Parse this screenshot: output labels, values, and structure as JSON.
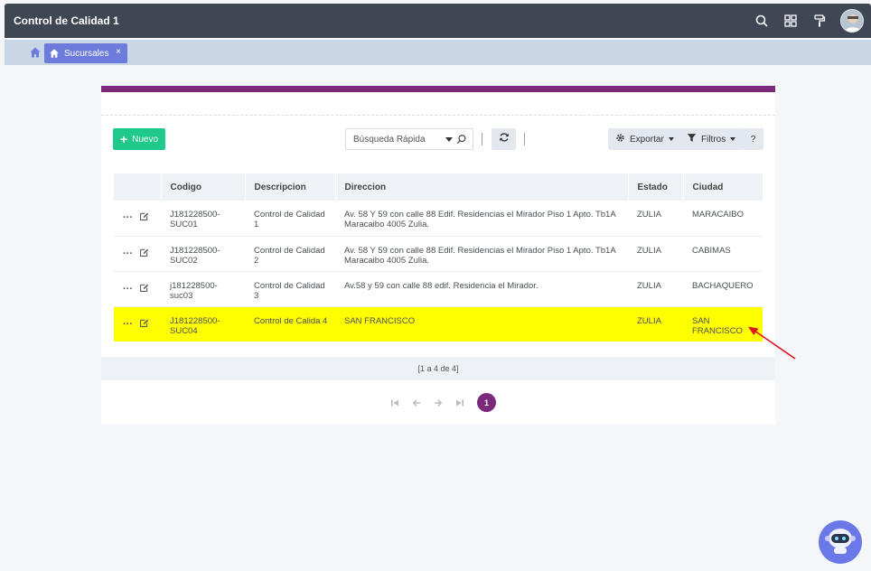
{
  "app": {
    "title": "Control de Calidad 1"
  },
  "header": {
    "icons": [
      "search-icon",
      "grid-icon",
      "paint-roller-icon",
      "user-avatar"
    ]
  },
  "tabs": [
    {
      "label": "Sucursales",
      "icon": "home-icon",
      "close": "×"
    }
  ],
  "toolbar": {
    "nuevo_label": "Nuevo",
    "search_placeholder": "Búsqueda Rápida",
    "exportar_label": "Exportar",
    "filtros_label": "Filtros",
    "help_label": "?"
  },
  "table": {
    "columns": [
      "Codigo",
      "Descripcion",
      "Direccion",
      "Estado",
      "Ciudad"
    ],
    "rows": [
      {
        "codigo": "J181228500-SUC01",
        "descripcion": "Control de Calidad 1",
        "direccion": "Av. 58 Y 59 con calle 88 Edif. Residencias el Mirador Piso 1 Apto. Tb1A Maracaibo 4005 Zulia.",
        "estado": "ZULIA",
        "ciudad": "MARACAIBO"
      },
      {
        "codigo": "J181228500-SUC02",
        "descripcion": "Control de Calidad 2",
        "direccion": "Av. 58 Y 59 con calle 88 Edif. Residencias el Mirador Piso 1 Apto. Tb1A Maracaibo 4005 Zulia.",
        "estado": "ZULIA",
        "ciudad": "CABIMAS"
      },
      {
        "codigo": "j181228500-suc03",
        "descripcion": "Control de Calidad 3",
        "direccion": "Av.58 y 59 con calle 88 edif. Residencia el Mirador.",
        "estado": "ZULIA",
        "ciudad": "BACHAQUERO"
      },
      {
        "codigo": "J181228500-SUC04",
        "descripcion": "Control de Calida 4",
        "direccion": "SAN FRANCISCO",
        "estado": "ZULIA",
        "ciudad": "SAN FRANCISCO",
        "highlighted": true
      }
    ]
  },
  "pagination": {
    "summary": "[1 a 4 de 4]",
    "current_page": "1"
  },
  "colors": {
    "accent": "#7b2a7b",
    "primary": "#6d7bdc",
    "success": "#1ec98b",
    "highlight": "#ffff00",
    "topbar": "#3f4654"
  }
}
